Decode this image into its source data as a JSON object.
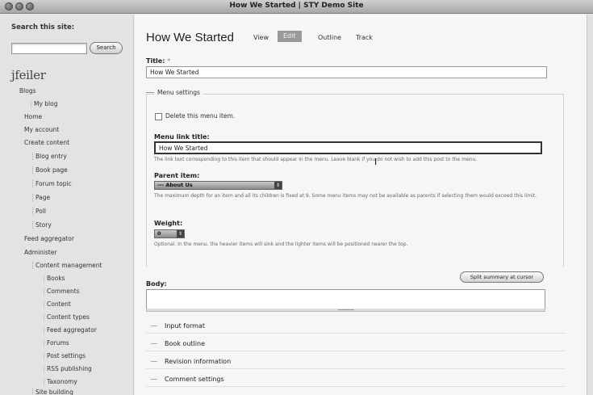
{
  "window": {
    "title": "How We Started | STY Demo Site"
  },
  "sidebar": {
    "search_label": "Search this site:",
    "search_button": "Search",
    "search_value": "",
    "username": "jfeiler",
    "nav": [
      {
        "label": "Blogs"
      },
      {
        "label": "My blog"
      },
      {
        "label": "Home"
      },
      {
        "label": "My account"
      },
      {
        "label": "Create content"
      },
      {
        "label": "Blog entry"
      },
      {
        "label": "Book page"
      },
      {
        "label": "Forum topic"
      },
      {
        "label": "Page"
      },
      {
        "label": "Poll"
      },
      {
        "label": "Story"
      },
      {
        "label": "Feed aggregator"
      },
      {
        "label": "Administer"
      },
      {
        "label": "Content management"
      },
      {
        "label": "Books"
      },
      {
        "label": "Comments"
      },
      {
        "label": "Content"
      },
      {
        "label": "Content types"
      },
      {
        "label": "Feed aggregator"
      },
      {
        "label": "Forums"
      },
      {
        "label": "Post settings"
      },
      {
        "label": "RSS publishing"
      },
      {
        "label": "Taxonomy"
      },
      {
        "label": "Site building"
      }
    ]
  },
  "main": {
    "page_title": "How We Started",
    "tabs": [
      {
        "label": "View"
      },
      {
        "label": "Edit"
      },
      {
        "label": "Outline"
      },
      {
        "label": "Track"
      }
    ],
    "title_label": "Title:",
    "title_required": "*",
    "title_value": "How We Started",
    "menu_settings": {
      "legend": "Menu settings",
      "delete_label": "Delete this menu item.",
      "link_title_label": "Menu link title:",
      "link_title_value": "How We Started",
      "link_title_help": "The link text corresponding to this item that should appear in the menu. Leave blank if you do not wish to add this post to the menu.",
      "parent_label": "Parent item:",
      "parent_value": "--- About Us",
      "parent_help": "The maximum depth for an item and all its children is fixed at 9. Some menu items may not be available as parents if selecting them would exceed this limit.",
      "weight_label": "Weight:",
      "weight_value": "0",
      "weight_help": "Optional. In the menu, the heavier items will sink and the lighter items will be positioned nearer the top."
    },
    "split_button": "Split summary at cursor",
    "body_label": "Body:",
    "sections": [
      {
        "label": "Input format"
      },
      {
        "label": "Book outline"
      },
      {
        "label": "Revision information"
      },
      {
        "label": "Comment settings"
      }
    ]
  }
}
